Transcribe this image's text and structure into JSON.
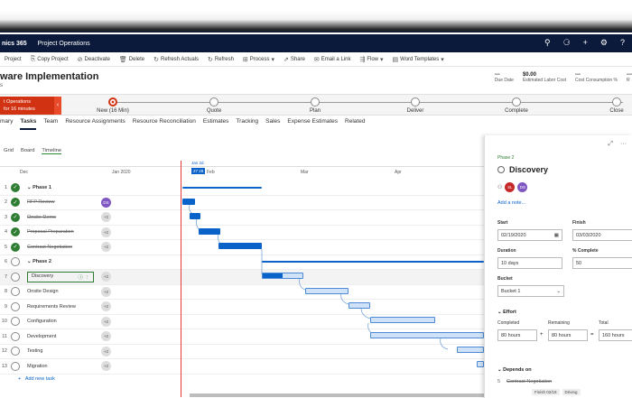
{
  "nav": {
    "app_name": "nics 365",
    "area": "Project Operations"
  },
  "commands": [
    "Project",
    "Copy Project",
    "Deactivate",
    "Delete",
    "Refresh Actuals",
    "Refresh",
    "Process",
    "Share",
    "Email a Link",
    "Flow",
    "Word Templates"
  ],
  "header": {
    "title": "ware Implementation",
    "subtitle": "s",
    "metrics": [
      {
        "value": "---",
        "label": "Due Date"
      },
      {
        "value": "$0.00",
        "label": "Estimated Labor Cost"
      },
      {
        "value": "---",
        "label": "Cost Consumption %"
      },
      {
        "value": "---",
        "label": "R"
      }
    ]
  },
  "bpf": {
    "active_box": "t Operations\nfor 16 minutes",
    "stages": [
      "New  (16 Min)",
      "Quote",
      "Plan",
      "Deliver",
      "Complete",
      "Close"
    ]
  },
  "tabs": [
    "mary",
    "Tasks",
    "Team",
    "Resource Assignments",
    "Resource Reconciliation",
    "Estimates",
    "Tracking",
    "Sales",
    "Expense Estimates",
    "Related"
  ],
  "view_tabs": [
    "Grid",
    "Board",
    "Timeline"
  ],
  "timeline": {
    "months": [
      "Dec",
      "Jan 2020",
      "Feb",
      "Mar",
      "Apr"
    ],
    "today_label": "Jan 2d",
    "date_box": "27 28"
  },
  "rows": [
    {
      "num": "1",
      "name": "Phase 1",
      "status": "done",
      "phase": true,
      "strike": true,
      "assignee": ""
    },
    {
      "num": "2",
      "name": "RFP Review",
      "status": "done",
      "phase": false,
      "strike": true,
      "assignee": "DS"
    },
    {
      "num": "3",
      "name": "Onsite Demo",
      "status": "done",
      "phase": false,
      "strike": true,
      "assignee": "+2"
    },
    {
      "num": "4",
      "name": "Proposal Preparation",
      "status": "done",
      "phase": false,
      "strike": true,
      "assignee": "+2"
    },
    {
      "num": "5",
      "name": "Contract Negotiation",
      "status": "done",
      "phase": false,
      "strike": true,
      "assignee": "+2"
    },
    {
      "num": "6",
      "name": "Phase 2",
      "status": "open",
      "phase": true,
      "strike": false,
      "assignee": ""
    },
    {
      "num": "7",
      "name": "Discovery",
      "status": "open",
      "phase": false,
      "strike": false,
      "assignee": "+2"
    },
    {
      "num": "8",
      "name": "Onsite Design",
      "status": "open",
      "phase": false,
      "strike": false,
      "assignee": "+2"
    },
    {
      "num": "9",
      "name": "Requirements Review",
      "status": "open",
      "phase": false,
      "strike": false,
      "assignee": "+2"
    },
    {
      "num": "10",
      "name": "Configuration",
      "status": "open",
      "phase": false,
      "strike": false,
      "assignee": "+2"
    },
    {
      "num": "11",
      "name": "Development",
      "status": "open",
      "phase": false,
      "strike": false,
      "assignee": "+2"
    },
    {
      "num": "12",
      "name": "Testing",
      "status": "open",
      "phase": false,
      "strike": false,
      "assignee": "+2"
    },
    {
      "num": "13",
      "name": "Migration",
      "status": "open",
      "phase": false,
      "strike": false,
      "assignee": "+2"
    }
  ],
  "add_task": "Add new task",
  "panel": {
    "phase": "Phase 2",
    "title": "Discovery",
    "avatars": [
      "SL",
      "DS"
    ],
    "add_note": "Add a note...",
    "start_label": "Start",
    "start_value": "02/19/2020",
    "finish_label": "Finish",
    "finish_value": "03/03/2020",
    "duration_label": "Duration",
    "duration_value": "10 days",
    "complete_label": "% Complete",
    "complete_value": "50",
    "bucket_label": "Bucket",
    "bucket_value": "Bucket 1",
    "effort_label": "Effort",
    "completed_label": "Completed",
    "completed_value": "80 hours",
    "remaining_label": "Remaining",
    "remaining_value": "80 hours",
    "total_label": "Total",
    "total_value": "160 hours",
    "depends_label": "Depends on",
    "dep_num": "5",
    "dep_name": "Contract Negotiation",
    "dep_tags": [
      "Finish 02/18",
      "Driving"
    ]
  }
}
